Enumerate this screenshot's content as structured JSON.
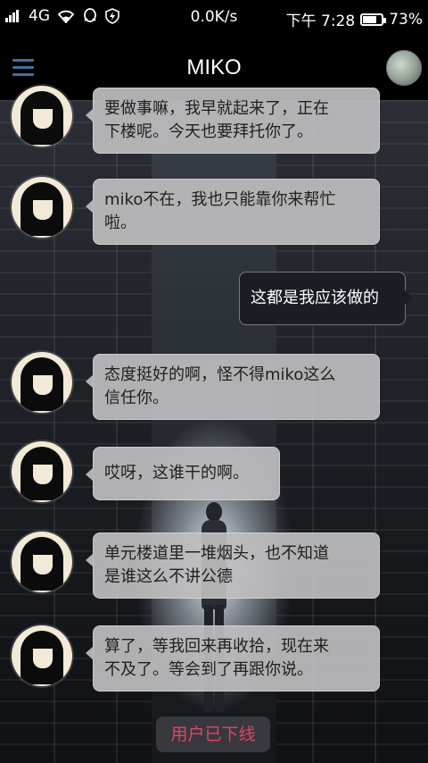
{
  "status_bar": {
    "network": "4G",
    "speed": "0.0K/s",
    "time": "下午 7:28",
    "battery": "73%",
    "battery_level": 0.73
  },
  "header": {
    "title": "MIKO",
    "menu_icon": "menu-icon",
    "avatar_icon": "contact-avatar"
  },
  "messages": [
    {
      "side": "in",
      "text_lines": [
        "要做事嘛，我早就起来了，正在",
        "下楼呢。今天也要拜托你了。"
      ]
    },
    {
      "side": "in",
      "text_lines": [
        "miko不在，我也只能靠你来帮忙",
        "啦。"
      ]
    },
    {
      "side": "out",
      "text_lines": [
        "这都是我应该做的"
      ]
    },
    {
      "side": "in",
      "text_lines": [
        "态度挺好的啊，怪不得miko这么",
        "信任你。"
      ]
    },
    {
      "side": "in",
      "text_lines": [
        "哎呀，这谁干的啊。"
      ]
    },
    {
      "side": "in",
      "text_lines": [
        "单元楼道里一堆烟头，也不知道",
        "是谁这么不讲公德"
      ]
    },
    {
      "side": "in",
      "text_lines": [
        "算了，等我回来再收拾，现在来",
        "不及了。等会到了再跟你说。"
      ]
    }
  ],
  "footer": {
    "offline_label": "用户已下线"
  },
  "colors": {
    "accent_blue": "#3f6ea0",
    "offline_red": "#e0446a"
  }
}
